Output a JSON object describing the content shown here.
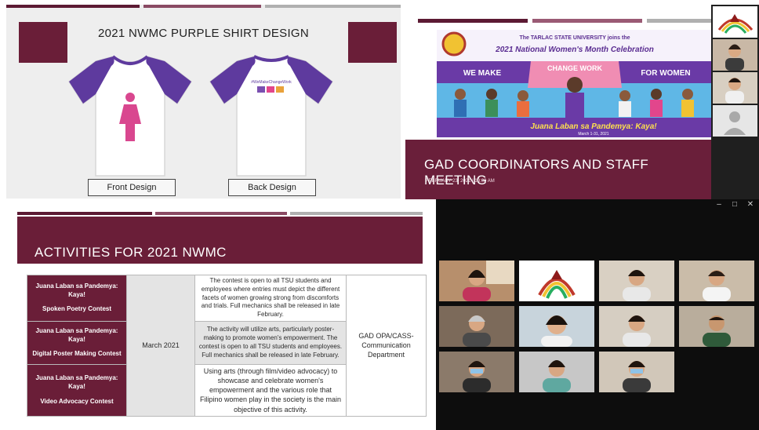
{
  "slide_shirt": {
    "title": "2021 NWMC PURPLE SHIRT DESIGN",
    "back_print": "#WeMakeChangeWork",
    "front_caption": "Front Design",
    "back_caption": "Back Design"
  },
  "slide_meeting": {
    "banner": {
      "line1": "The TARLAC STATE UNIVERSITY joins the",
      "line2": "2021 National Women's Month Celebration",
      "we_make": "WE MAKE",
      "change_work": "CHANGE WORK",
      "for_women": "FOR WOMEN",
      "tagline": "Juana Laban sa Pandemya: Kaya!",
      "dates": "March 1-31, 2021"
    },
    "title": "GAD COORDINATORS AND STAFF MEETING",
    "date": "FEBRUARY 23, 2021 | 10:00 AM"
  },
  "slide_activities": {
    "heading": "ACTIVITIES FOR 2021 NWMC",
    "date_cell": "March   2021",
    "responsible": "GAD OPA/CASS-Communication Department",
    "rows": [
      {
        "theme": "Juana Laban sa Pandemya: Kaya!",
        "activity": "Spoken Poetry Contest",
        "description": "The contest is open to all TSU students and employees where entries must depict the different facets of women growing strong from discomforts and trials. Full mechanics shall be released in late February."
      },
      {
        "theme": "Juana Laban sa Pandemya: Kaya!",
        "activity": "Digital Poster Making Contest",
        "description": "The activity will utilize arts, particularly poster-making to promote women's empowerment. The contest is open to all TSU students and employees. Full mechanics shall be released in late February."
      },
      {
        "theme": "Juana Laban sa Pandemya: Kaya!",
        "activity": "Video Advocacy Contest",
        "description": "Using arts (through film/video advocacy) to showcase and celebrate women's empowerment and the various role that Filipino women play in the society is the main objective of this activity."
      }
    ]
  },
  "zoom_window": {
    "controls": {
      "minimize": "–",
      "maximize": "□",
      "close": "✕"
    }
  },
  "colors": {
    "maroon": "#6a1e38",
    "purple": "#5e3a9e",
    "zoom_bg": "#0d0d0d"
  }
}
